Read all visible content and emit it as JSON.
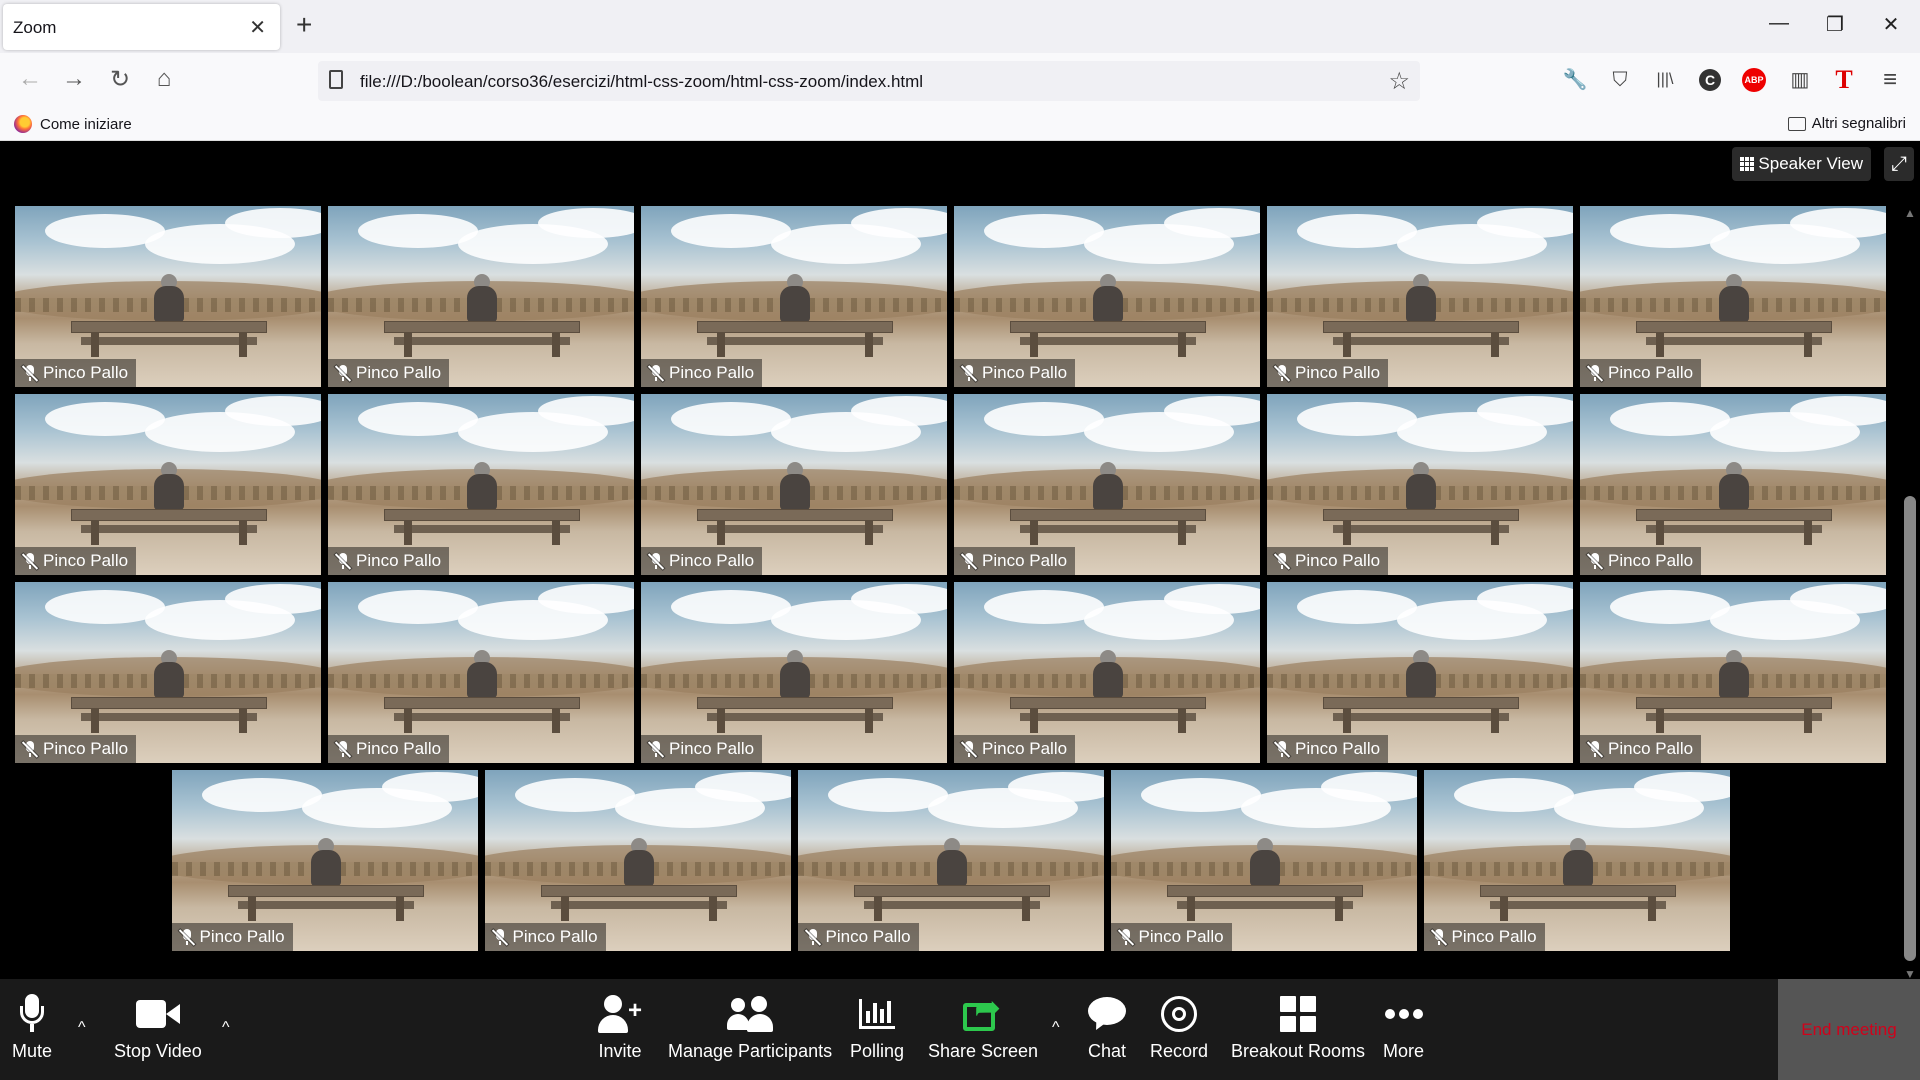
{
  "browser": {
    "tab_title": "Zoom",
    "tab_close": "✕",
    "new_tab": "+",
    "window_controls": {
      "minimize": "—",
      "restore": "❐",
      "close": "✕"
    },
    "nav": {
      "back": "←",
      "forward": "→",
      "reload": "↻",
      "home": "⌂"
    },
    "url": "file:///D:/boolean/corso36/esercizi/html-css-zoom/html-css-zoom/index.html",
    "bookmark_star": "☆",
    "extensions": [
      "wrench-icon",
      "pocket-icon",
      "library-icon",
      "c-extension-icon",
      "adblock-plus-icon",
      "reader-icon",
      "t-extension-icon",
      "menu-icon"
    ],
    "ext_labels": {
      "wrench": "🔧",
      "pocket": "⛉",
      "library": "|||\\",
      "c": "C",
      "abp": "ABP",
      "reader": "▥",
      "t": "T",
      "menu": "≡"
    },
    "bookmarks": {
      "first": "Come iniziare",
      "other": "Altri segnalibri"
    }
  },
  "zoom": {
    "speaker_view_label": "Speaker View",
    "fullscreen_icon": "⤢",
    "participants": [
      "Pinco Pallo",
      "Pinco Pallo",
      "Pinco Pallo",
      "Pinco Pallo",
      "Pinco Pallo",
      "Pinco Pallo",
      "Pinco Pallo",
      "Pinco Pallo",
      "Pinco Pallo",
      "Pinco Pallo",
      "Pinco Pallo",
      "Pinco Pallo",
      "Pinco Pallo",
      "Pinco Pallo",
      "Pinco Pallo",
      "Pinco Pallo",
      "Pinco Pallo",
      "Pinco Pallo",
      "Pinco Pallo",
      "Pinco Pallo",
      "Pinco Pallo",
      "Pinco Pallo",
      "Pinco Pallo"
    ],
    "participant_muted": true,
    "toolbar": {
      "mute": "Mute",
      "stop_video": "Stop Video",
      "invite": "Invite",
      "manage_participants": "Manage Participants",
      "polling": "Polling",
      "share_screen": "Share Screen",
      "chat": "Chat",
      "record": "Record",
      "breakout_rooms": "Breakout Rooms",
      "more": "More",
      "end_meeting": "End meeting",
      "caret": "^"
    },
    "colors": {
      "share_accent": "#2dc84d",
      "end_meeting_text": "#d0021b",
      "toolbar_bg": "#1a1a1a"
    }
  }
}
